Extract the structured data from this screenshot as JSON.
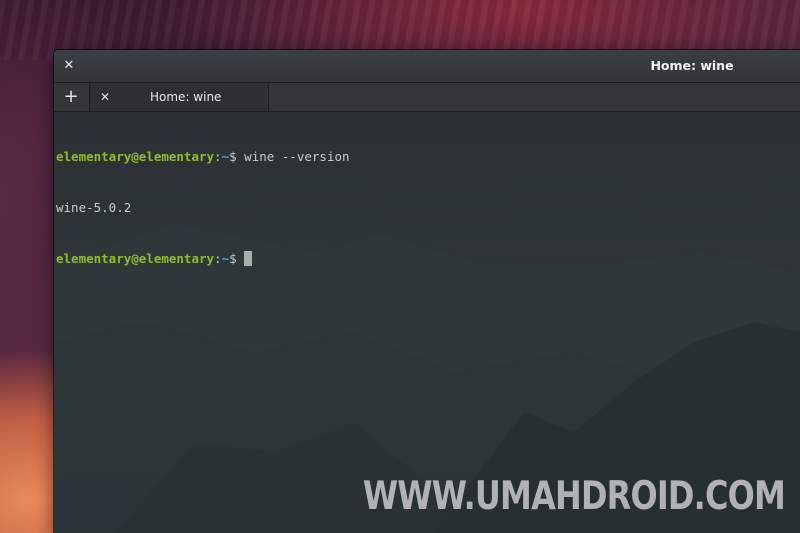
{
  "window": {
    "title": "Home: wine",
    "close_icon": "close-icon"
  },
  "tabs": {
    "new_tab_icon": "plus-icon",
    "items": [
      {
        "label": "Home: wine",
        "close_icon": "close-icon"
      }
    ]
  },
  "terminal": {
    "lines": [
      {
        "user": "elementary@elementary",
        "sep": ":",
        "path": "~",
        "symbol": "$ ",
        "command": "wine --version"
      },
      {
        "output": "wine-5.0.2"
      },
      {
        "user": "elementary@elementary",
        "sep": ":",
        "path": "~",
        "symbol": "$ ",
        "command": ""
      }
    ]
  },
  "watermark": "WWW.UMAHDROID.COM",
  "colors": {
    "prompt_user": "#8fbd27",
    "prompt_path": "#4fa3d6",
    "terminal_text": "#c8ccc9",
    "terminal_bg": "#2b3134"
  }
}
